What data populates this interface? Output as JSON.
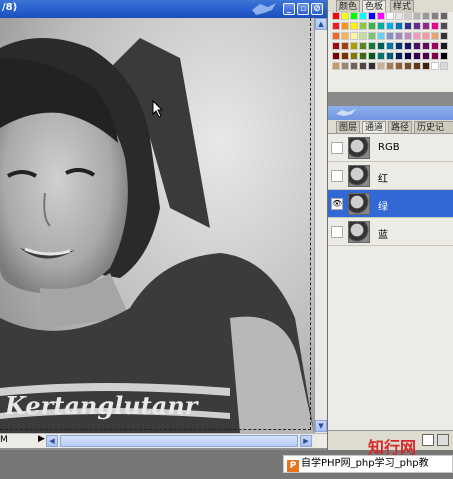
{
  "document": {
    "title": "/8)",
    "zoom": "M",
    "title_buttons": [
      "_",
      "▫",
      "⊘"
    ]
  },
  "swatches": {
    "tabs": [
      "颜色",
      "色板",
      "样式"
    ],
    "active_tab": 1,
    "rows": [
      [
        "#ff0000",
        "#ffff00",
        "#00ff00",
        "#00ffff",
        "#0000ff",
        "#ff00ff",
        "#ffffff",
        "#e6e6e6",
        "#cccccc",
        "#b3b3b3",
        "#999999",
        "#808080",
        "#666666"
      ],
      [
        "#ed1c24",
        "#f7931e",
        "#fff200",
        "#8dc63f",
        "#39b54a",
        "#00a99d",
        "#00aeef",
        "#0072bc",
        "#2e3192",
        "#662d91",
        "#92278f",
        "#ec008c",
        "#4d4d4d"
      ],
      [
        "#f26522",
        "#fbaf5d",
        "#fff799",
        "#c4df9b",
        "#7cc576",
        "#6dcff6",
        "#8393ca",
        "#a186be",
        "#bd8cbf",
        "#f49ac1",
        "#f6989d",
        "#e9a36d",
        "#333333"
      ],
      [
        "#9e0b0f",
        "#a0410d",
        "#aba000",
        "#598527",
        "#197b30",
        "#005e56",
        "#0076a3",
        "#003471",
        "#1b1464",
        "#440e62",
        "#630460",
        "#9e005d",
        "#1a1a1a"
      ],
      [
        "#790000",
        "#7b2e00",
        "#827b00",
        "#406618",
        "#005e20",
        "#00746b",
        "#005b7f",
        "#002157",
        "#0d004c",
        "#32004b",
        "#4b0049",
        "#7b0046",
        "#000000"
      ],
      [
        "#c69c6d",
        "#998675",
        "#736357",
        "#534741",
        "#362f2d",
        "#c7b299",
        "#a67c52",
        "#8c6239",
        "#754c24",
        "#603913",
        "#42210b",
        "#ffffff",
        "#d9d9d9"
      ]
    ]
  },
  "channels_panel": {
    "tabs": [
      "图层",
      "通道",
      "路径",
      "历史记录"
    ],
    "active_tab": 1,
    "channels": [
      {
        "name": "RGB",
        "visible": false,
        "selected": false
      },
      {
        "name": "红",
        "visible": false,
        "selected": false
      },
      {
        "name": "绿",
        "visible": true,
        "selected": true
      },
      {
        "name": "蓝",
        "visible": false,
        "selected": false
      }
    ]
  },
  "watermarks": {
    "site1": "知行网",
    "site2": "自学PHP网_php学习_php教"
  },
  "colors": {
    "title_bar": "#255fd0",
    "selection_highlight": "#3168d5",
    "panel_bg": "#ecebe5"
  }
}
